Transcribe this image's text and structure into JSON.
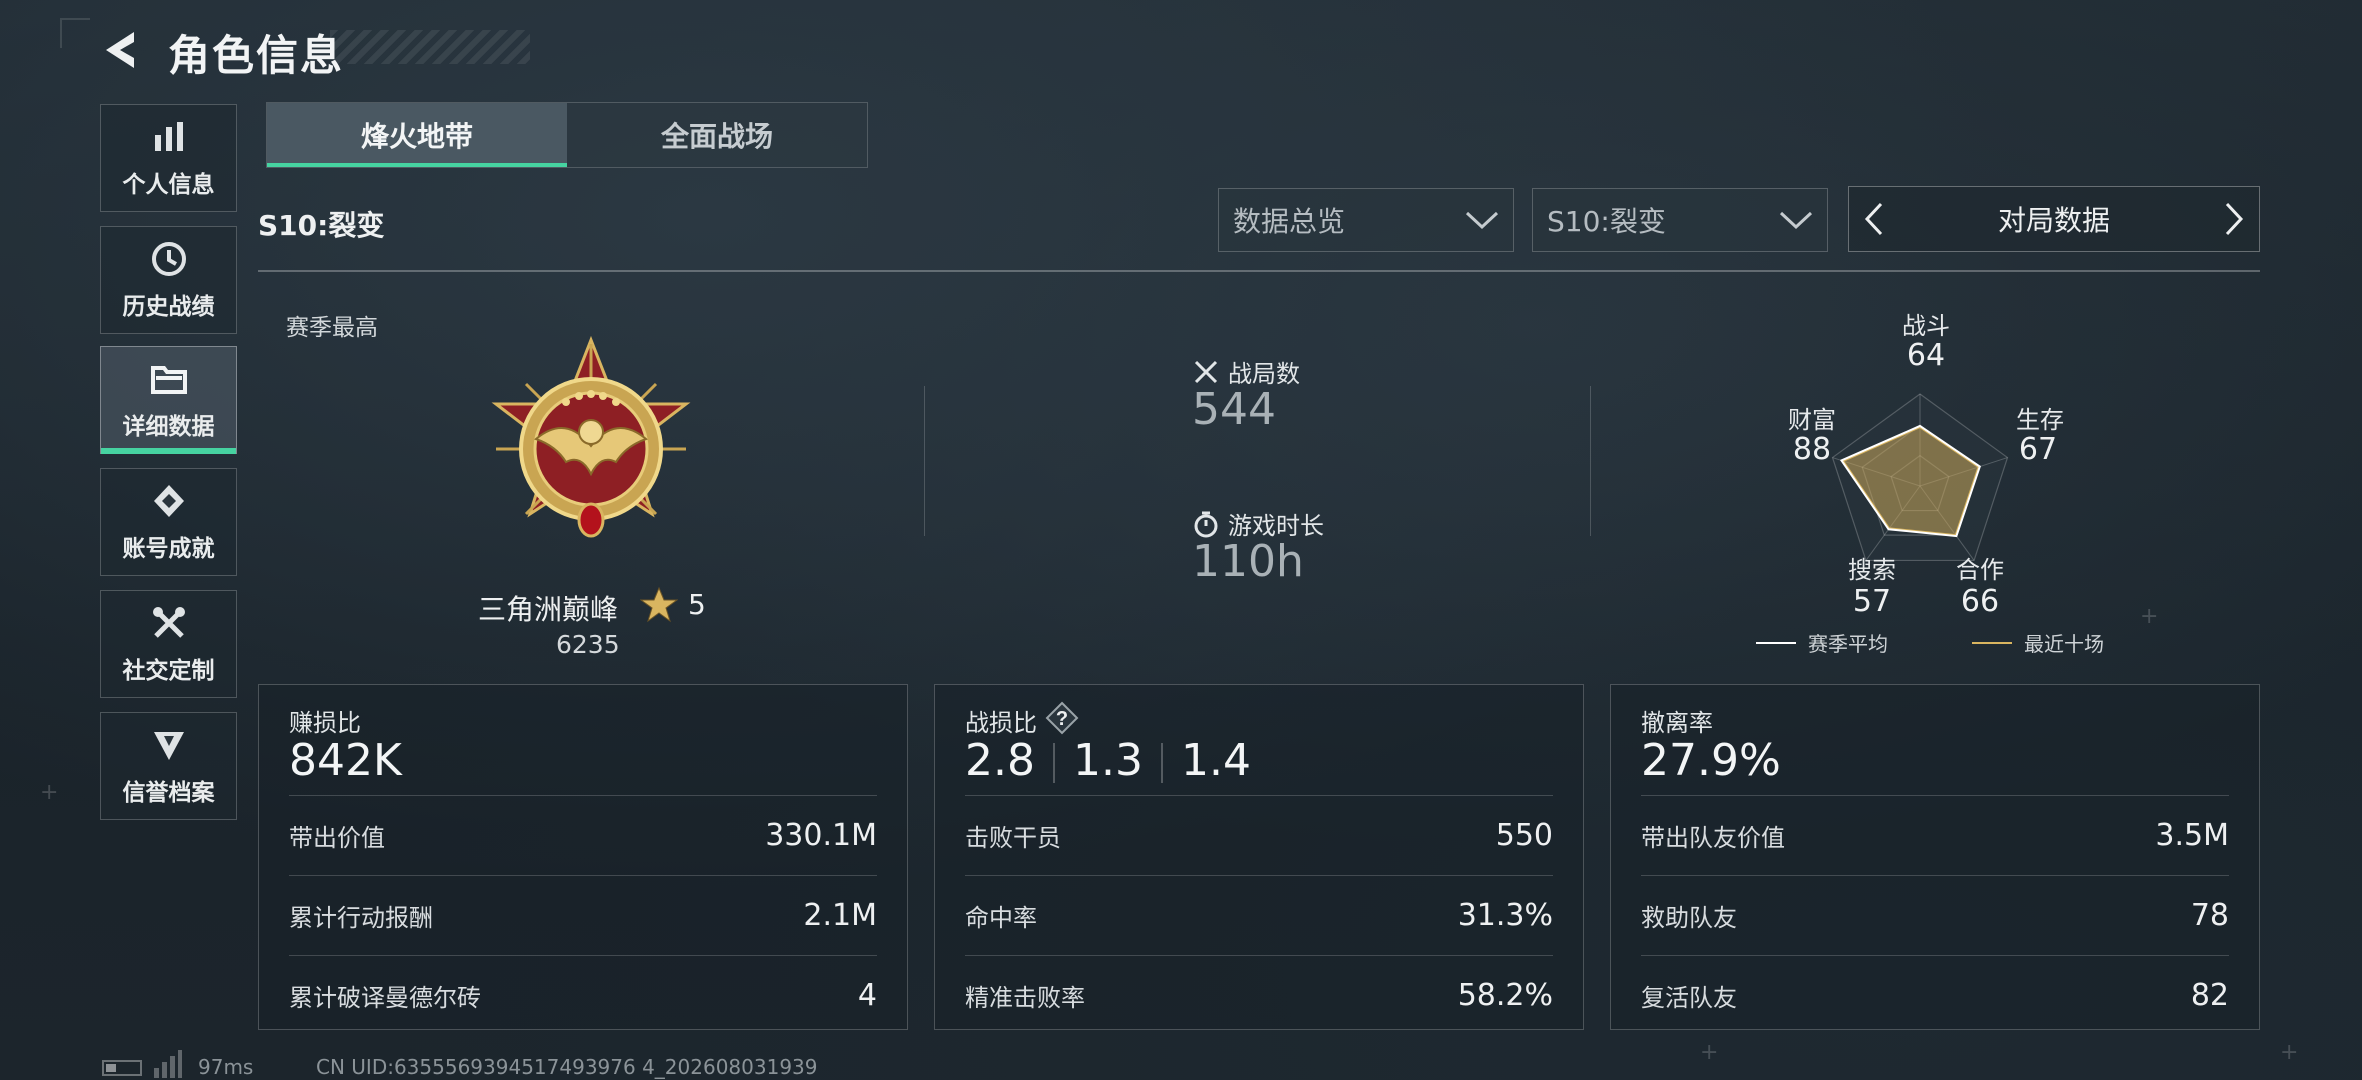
{
  "header": {
    "title": "角色信息"
  },
  "sidebar": {
    "items": [
      {
        "label": "个人信息",
        "icon": "bar-chart-icon"
      },
      {
        "label": "历史战绩",
        "icon": "history-icon"
      },
      {
        "label": "详细数据",
        "icon": "folder-icon",
        "active": true
      },
      {
        "label": "账号成就",
        "icon": "achievement-icon"
      },
      {
        "label": "社交定制",
        "icon": "tools-icon"
      },
      {
        "label": "信誉档案",
        "icon": "shield-badge-icon"
      }
    ]
  },
  "tabs": [
    {
      "label": "烽火地带",
      "active": true
    },
    {
      "label": "全面战场",
      "active": false
    }
  ],
  "season": {
    "label": "S10:裂变"
  },
  "filters": {
    "overview": "数据总览",
    "season": "S10:裂变",
    "mode": "对局数据"
  },
  "rank": {
    "caption": "赛季最高",
    "name": "三角洲巅峰",
    "stars": "5",
    "score": "6235"
  },
  "summary": {
    "matches_label": "战局数",
    "matches_value": "544",
    "playtime_label": "游戏时长",
    "playtime_value": "110h"
  },
  "radar": {
    "axes": [
      {
        "label": "战斗",
        "value": "64"
      },
      {
        "label": "生存",
        "value": "67"
      },
      {
        "label": "合作",
        "value": "66"
      },
      {
        "label": "搜索",
        "value": "57"
      },
      {
        "label": "财富",
        "value": "88"
      }
    ],
    "legend": {
      "season_avg": "赛季平均",
      "recent": "最近十场"
    },
    "colors": {
      "season_avg": "#ffffff",
      "recent": "#d9b560"
    }
  },
  "cards": {
    "profit": {
      "title": "赚损比",
      "value": "842K",
      "rows": [
        {
          "k": "带出价值",
          "v": "330.1M"
        },
        {
          "k": "累计行动报酬",
          "v": "2.1M"
        },
        {
          "k": "累计破译曼德尔砖",
          "v": "4"
        }
      ]
    },
    "kd": {
      "title": "战损比",
      "values": [
        "2.8",
        "1.3",
        "1.4"
      ],
      "rows": [
        {
          "k": "击败干员",
          "v": "550"
        },
        {
          "k": "命中率",
          "v": "31.3%"
        },
        {
          "k": "精准击败率",
          "v": "58.2%"
        }
      ]
    },
    "extract": {
      "title": "撤离率",
      "value": "27.9%",
      "rows": [
        {
          "k": "带出队友价值",
          "v": "3.5M"
        },
        {
          "k": "救助队友",
          "v": "78"
        },
        {
          "k": "复活队友",
          "v": "82"
        }
      ]
    }
  },
  "footer": {
    "ping": "97ms",
    "uid": "CN UID:6355569394517493976 4_202608031939"
  },
  "colors": {
    "accent": "#46d3a1",
    "gold": "#d9b560"
  }
}
